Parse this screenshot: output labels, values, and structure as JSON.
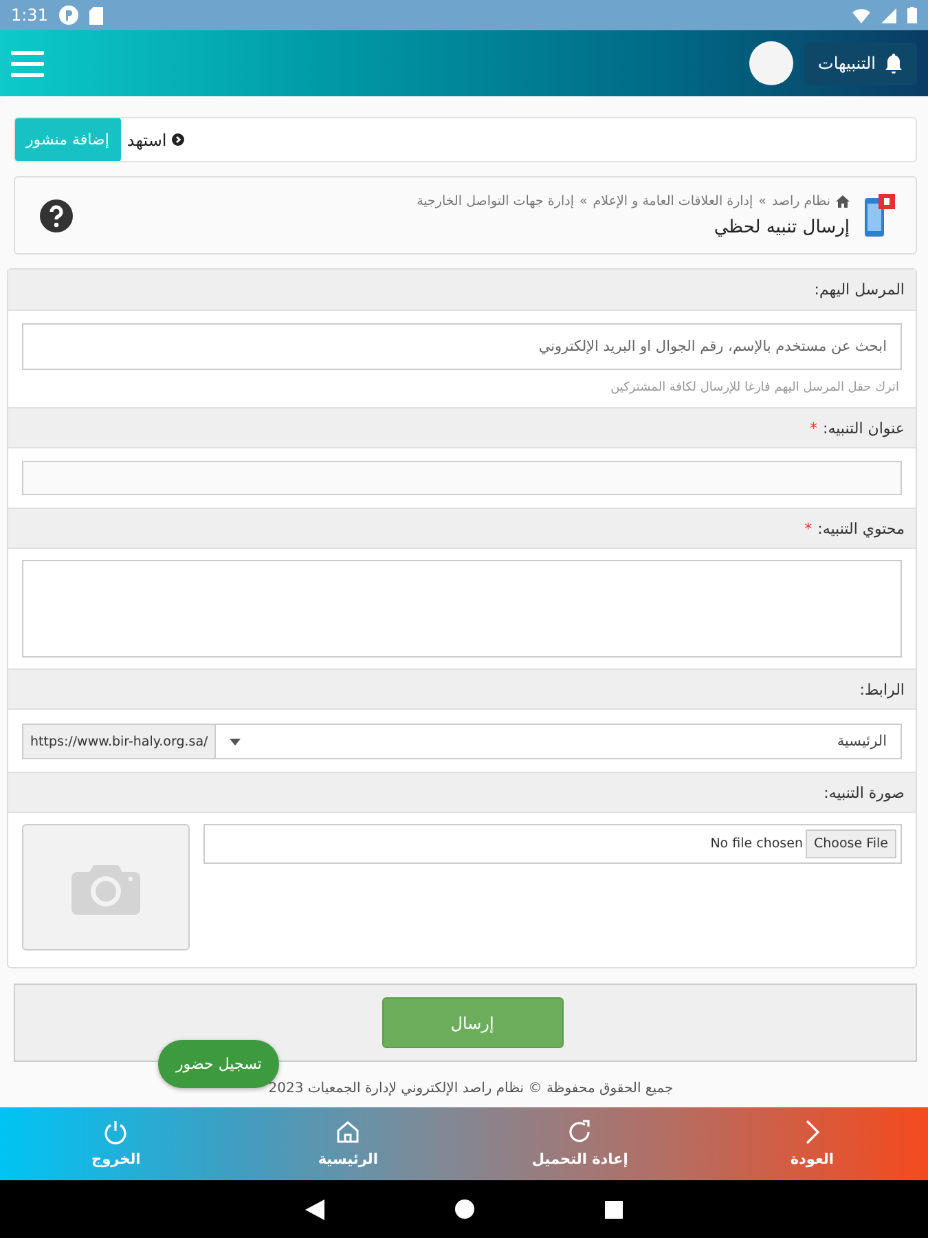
{
  "status_bar": {
    "time": "1:31"
  },
  "header": {
    "notifications_label": "التنبيهات"
  },
  "ticker": {
    "text": "استهد",
    "button": "إضافة منشور"
  },
  "breadcrumb": {
    "items": [
      {
        "label": "نظام راصد",
        "separator": "»"
      },
      {
        "label": "إدارة العلاقات العامة و الإعلام",
        "separator": "»"
      },
      {
        "label": "إدارة جهات التواصل الخارجية"
      }
    ],
    "title": "إرسال تنبيه لحظي"
  },
  "form": {
    "fields": [
      {
        "kind": "search",
        "label": "المرسل اليهم:",
        "placeholder": "ابحث عن مستخدم بالإسم، رقم الجوال او البريد الإلكتروني",
        "hint": "اترك حقل المرسل اليهم فارغا للإرسال لكافة المشتركين"
      },
      {
        "kind": "text",
        "label": "عنوان التنبيه:",
        "required_mark": "*"
      },
      {
        "kind": "textarea",
        "label": "محتوي التنبيه:",
        "required_mark": "*"
      },
      {
        "kind": "link",
        "label": "الرابط:",
        "value": "الرئيسية",
        "prefix": "https://www.bir-haly.org.sa/"
      },
      {
        "kind": "file",
        "label": "صورة التنبيه:",
        "button": "Choose File",
        "status": "No file chosen"
      }
    ]
  },
  "submit": "إرسال",
  "fab": "تسجيل حضور",
  "footer": "جميع الحقوق محفوظة © نظام راصد الإلكتروني لإدارة الجمعيات 2023",
  "bottom_nav": [
    {
      "kind": "back",
      "label": "العودة"
    },
    {
      "kind": "reload",
      "label": "إعادة التحميل"
    },
    {
      "kind": "home",
      "label": "الرئيسية"
    },
    {
      "kind": "power",
      "label": "الخروج"
    }
  ]
}
